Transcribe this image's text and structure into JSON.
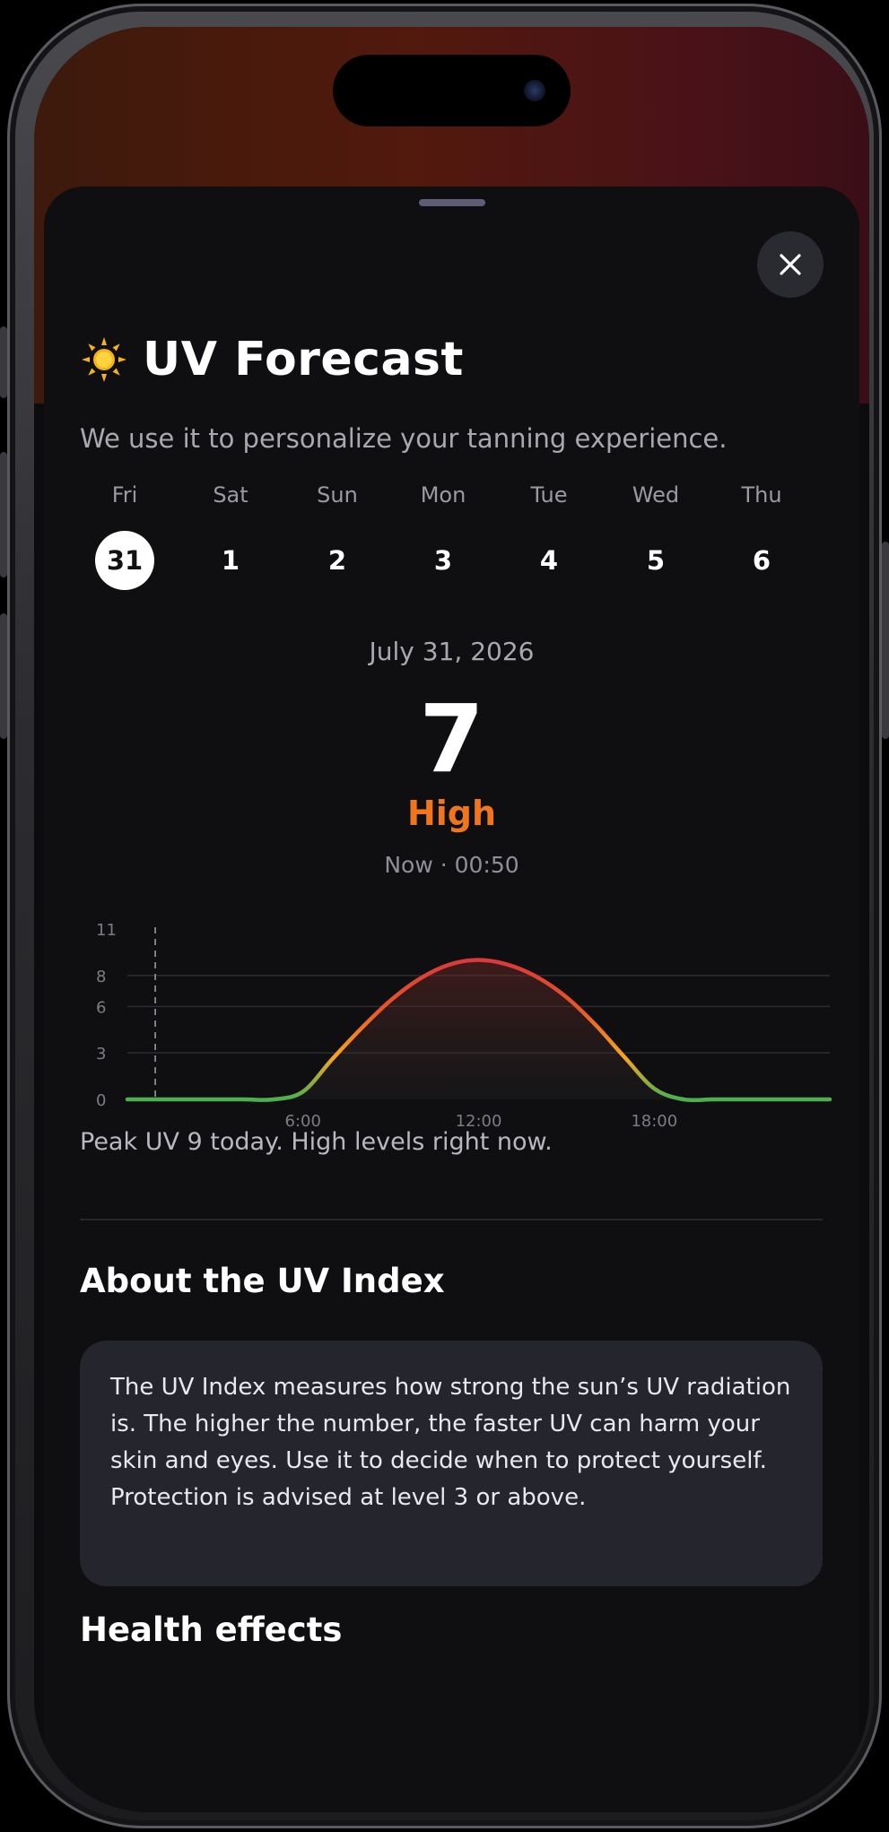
{
  "header": {
    "title": "UV Forecast",
    "subtitle": "We use it to personalize your tanning experience."
  },
  "icons": {
    "title_icon": "sun-emoji-icon",
    "close": "close-icon"
  },
  "days": [
    {
      "name": "Fri",
      "num": "31",
      "selected": true
    },
    {
      "name": "Sat",
      "num": "1",
      "selected": false
    },
    {
      "name": "Sun",
      "num": "2",
      "selected": false
    },
    {
      "name": "Mon",
      "num": "3",
      "selected": false
    },
    {
      "name": "Tue",
      "num": "4",
      "selected": false
    },
    {
      "name": "Wed",
      "num": "5",
      "selected": false
    },
    {
      "name": "Thu",
      "num": "6",
      "selected": false
    }
  ],
  "current": {
    "date": "July 31, 2026",
    "uv_value": "7",
    "level": "High",
    "time": "Now · 00:50"
  },
  "colors": {
    "level_high": "#f0761e",
    "uv_low": "#4caf50",
    "uv_mid": "#f5a623",
    "uv_high": "#e8552a",
    "uv_peak": "#d93a3a"
  },
  "chart_data": {
    "type": "area",
    "y_ticks": [
      "0",
      "3",
      "6",
      "8",
      "11"
    ],
    "x_ticks": [
      "6:00",
      "12:00",
      "18:00"
    ],
    "ylim": [
      0,
      11
    ],
    "xlim": [
      0,
      24
    ],
    "current_time_marker": 0.83,
    "series": [
      {
        "x": [
          0,
          1,
          2,
          3,
          4,
          5,
          6,
          7,
          8,
          9,
          10,
          11,
          12,
          13,
          14,
          15,
          16,
          17,
          18,
          19,
          20,
          21,
          22,
          23,
          24
        ],
        "values": [
          0,
          0,
          0,
          0,
          0,
          0,
          0.5,
          2.6,
          4.6,
          6.4,
          7.8,
          8.7,
          9.0,
          8.7,
          7.9,
          6.6,
          4.8,
          2.7,
          0.7,
          0,
          0,
          0,
          0,
          0,
          0
        ]
      }
    ],
    "grid": true
  },
  "summary": {
    "peak_text": "Peak UV 9 today. High levels right now."
  },
  "about": {
    "heading": "About the UV Index",
    "body": "The UV Index measures how strong the sun’s UV radiation is. The higher the number, the faster UV can harm your skin and eyes. Use it to decide when to protect yourself. Protection is advised at level 3 or above."
  },
  "health": {
    "heading": "Health effects"
  }
}
